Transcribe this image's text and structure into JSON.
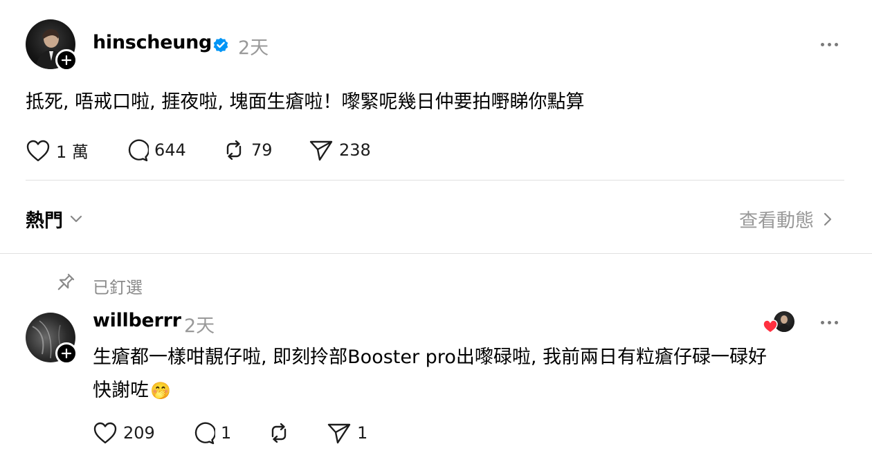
{
  "post": {
    "username": "hinscheung",
    "timestamp": "2天",
    "text": "抵死, 唔戒口啦, 捱夜啦, 塊面生瘡啦！嚟緊呢幾日仲要拍嘢睇你點算",
    "likes": "1 萬",
    "comments": "644",
    "reposts": "79",
    "shares": "238",
    "icons": [
      "verified-icon",
      "heart-icon",
      "comment-icon",
      "repost-icon",
      "share-icon",
      "more-icon",
      "plus-icon"
    ]
  },
  "filter": {
    "sort_label": "熱門",
    "activity_label": "查看動態"
  },
  "pinned": {
    "label": "已釘選"
  },
  "reply": {
    "username": "willberrr",
    "timestamp": "2天",
    "text_line1": "生瘡都一樣咁靚仔啦, 即刻拎部Booster pro出嚟碌啦, 我前兩日有粒瘡仔碌一碌好",
    "text_line2": "快謝咗",
    "emoji": "🤭",
    "likes": "209",
    "comments": "1",
    "reposts": "",
    "shares": "1"
  },
  "colors": {
    "verified_blue": "#0095f6",
    "muted_text": "#999999",
    "heart_red": "#ff3040"
  }
}
